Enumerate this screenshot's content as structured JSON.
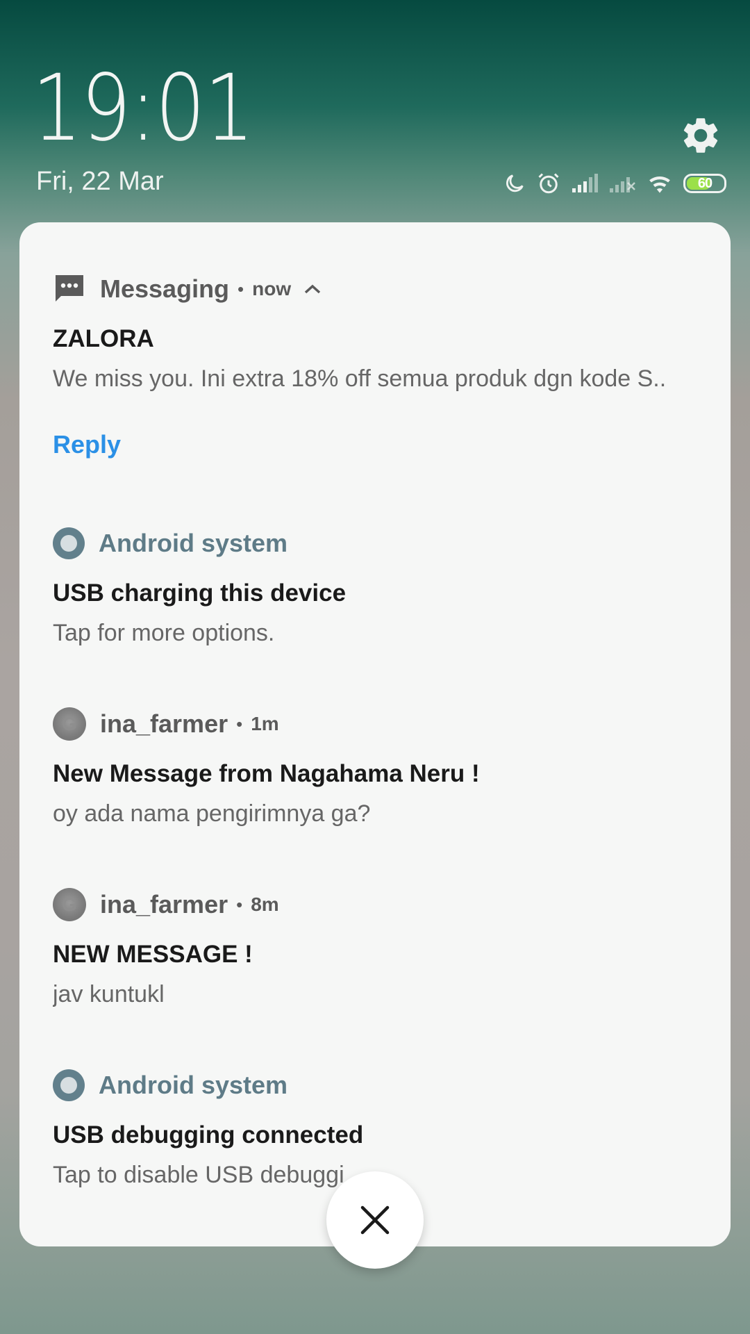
{
  "lockscreen": {
    "time": "19:01",
    "date": "Fri, 22 Mar"
  },
  "status_bar": {
    "icons": [
      "moon-icon",
      "alarm-icon",
      "signal-icon",
      "signal-no-service-icon",
      "wifi-icon"
    ],
    "battery_level": "60",
    "battery_color": "#9be04a"
  },
  "notifications": [
    {
      "app": "Messaging",
      "time": "now",
      "title": "ZALORA",
      "body": "We miss you. Ini extra 18% off semua produk dgn kode S..",
      "action": "Reply"
    },
    {
      "app": "Android system",
      "title": "USB charging this device",
      "body": "Tap for more options."
    },
    {
      "app": "ina_farmer",
      "time": "1m",
      "title": "New Message from Nagahama Neru !",
      "body": "oy ada nama pengirimnya ga?"
    },
    {
      "app": "ina_farmer",
      "time": "8m",
      "title": "NEW MESSAGE !",
      "body": "jav kuntukl"
    },
    {
      "app": "Android system",
      "title": "USB debugging connected",
      "body": "Tap to disable USB debuggi"
    }
  ],
  "colors": {
    "accent": "#2b90e6",
    "system_app": "#5e7b87"
  }
}
